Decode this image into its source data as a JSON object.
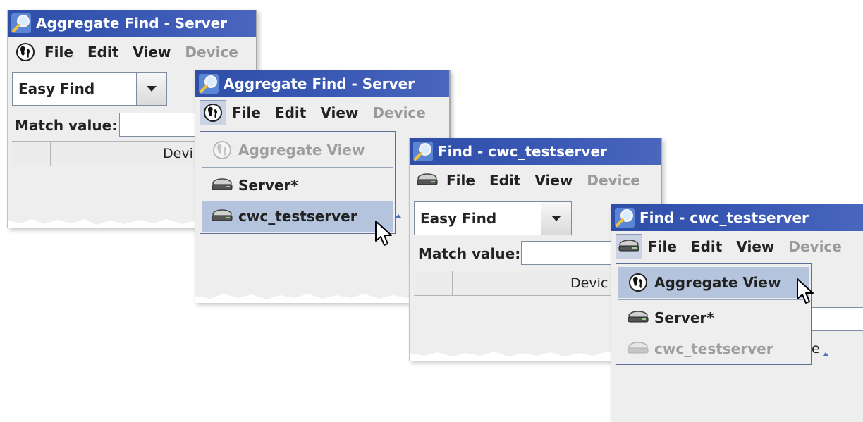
{
  "colors": {
    "title_bar": "#3a59b5",
    "menu_selection": "#b4c4dd",
    "panel_bg": "#eeeeee",
    "disabled_text": "#9a9a9a"
  },
  "panels": [
    {
      "title": "Aggregate Find - Server",
      "title_icon": "magnifier-icon",
      "view_icon": "globe-icon",
      "menu": {
        "file": "File",
        "edit": "Edit",
        "view": "View",
        "device": "Device"
      },
      "find_mode": "Easy Find",
      "match_label": "Match value:",
      "column_header": "Devi"
    },
    {
      "title": "Aggregate Find - Server",
      "title_icon": "magnifier-icon",
      "view_icon": "globe-icon",
      "menu": {
        "file": "File",
        "edit": "Edit",
        "view": "View",
        "device": "Device"
      },
      "dropdown": [
        {
          "label": "Aggregate View",
          "icon": "globe-icon",
          "state": "disabled"
        },
        {
          "label": "Server*",
          "icon": "server-icon",
          "state": "normal"
        },
        {
          "label": "cwc_testserver",
          "icon": "server-icon",
          "state": "selected"
        }
      ]
    },
    {
      "title": "Find - cwc_testserver",
      "title_icon": "magnifier-icon",
      "view_icon": "server-icon",
      "menu": {
        "file": "File",
        "edit": "Edit",
        "view": "View",
        "device": "Device"
      },
      "find_mode": "Easy Find",
      "match_label": "Match value:",
      "column_header": "Devic"
    },
    {
      "title": "Find - cwc_testserver",
      "title_icon": "magnifier-icon",
      "view_icon": "server-icon",
      "menu": {
        "file": "File",
        "edit": "Edit",
        "view": "View",
        "device": "Device"
      },
      "column_header_tail": "e",
      "dropdown": [
        {
          "label": "Aggregate View",
          "icon": "globe-icon",
          "state": "selected"
        },
        {
          "label": "Server*",
          "icon": "server-icon",
          "state": "normal"
        },
        {
          "label": "cwc_testserver",
          "icon": "server-icon",
          "state": "disabled"
        }
      ]
    }
  ]
}
